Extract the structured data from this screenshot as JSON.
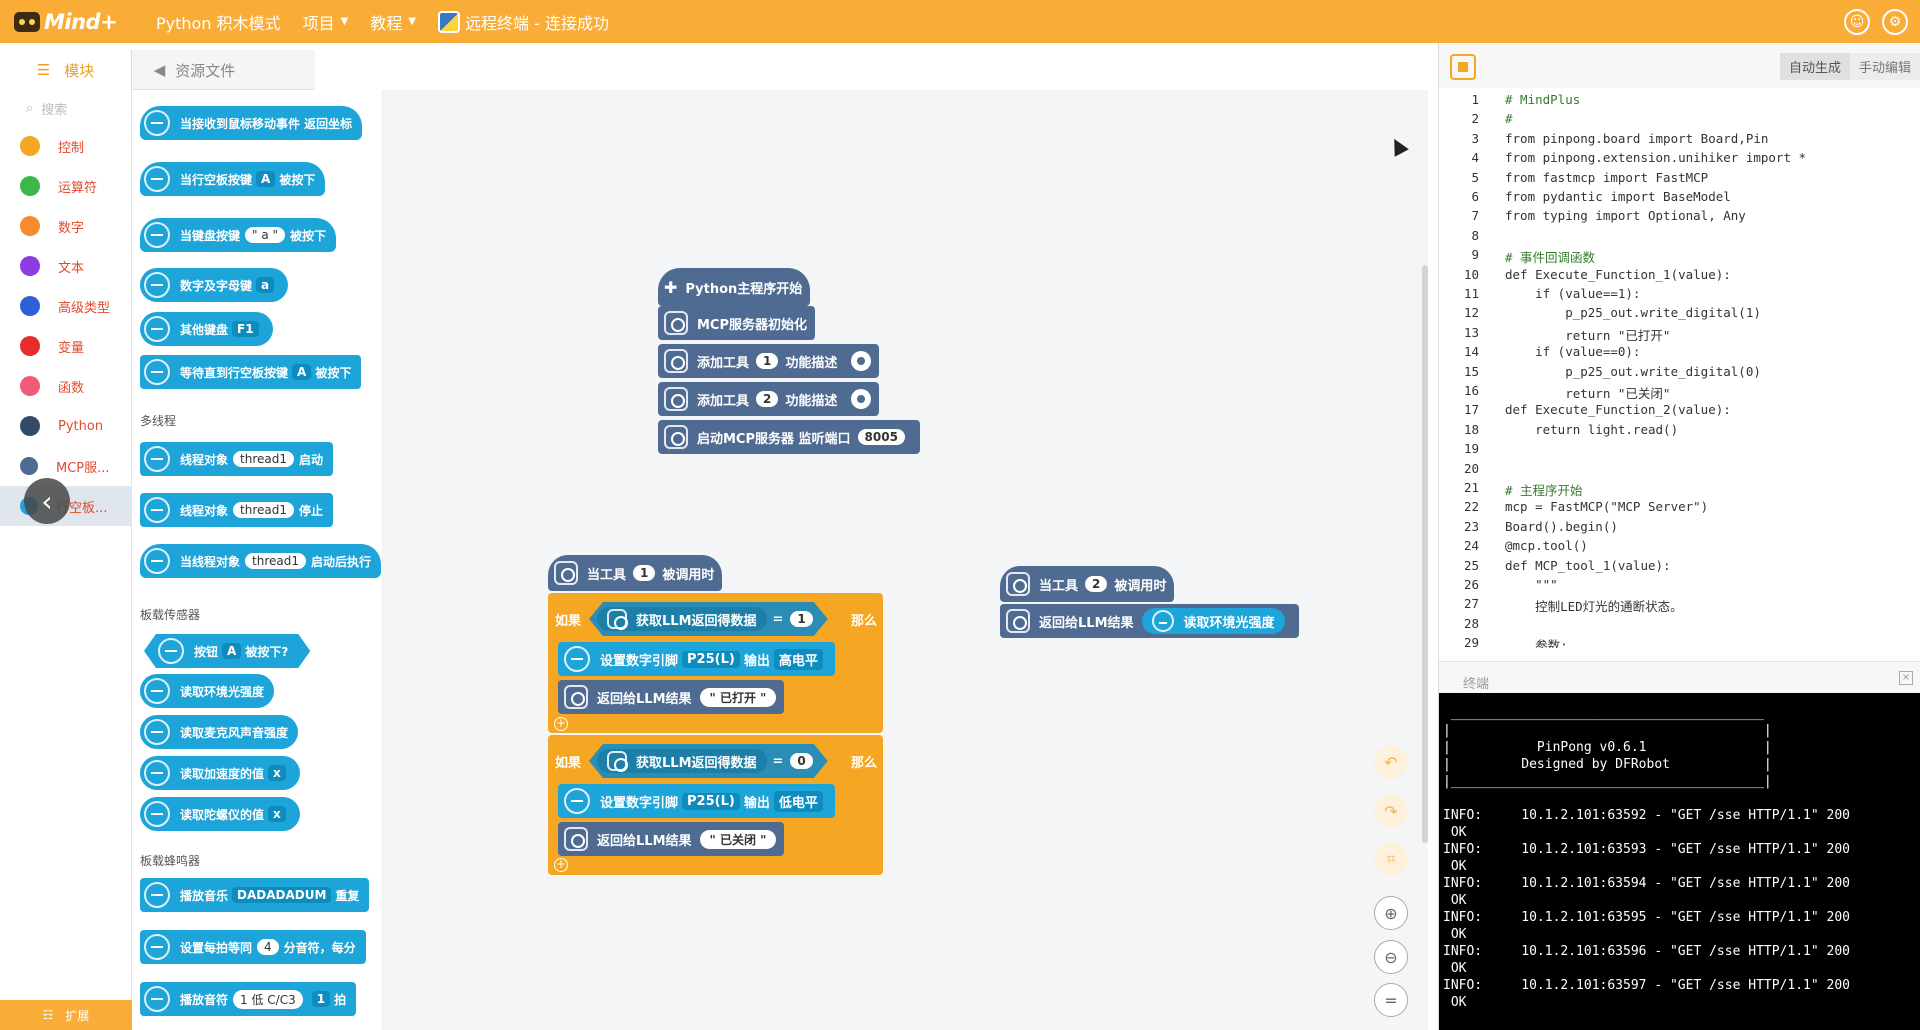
{
  "colors": {
    "brand": "#f9ad36",
    "block_blue": "#1da4d9",
    "mcp_block": "#4f6b92",
    "if_block": "#f5a623"
  },
  "topbar": {
    "logo_text": "Mind+",
    "mode": "Python 积木模式",
    "menu_project": "项目",
    "menu_tutorial": "教程",
    "remote_status": "远程终端 - 连接成功"
  },
  "left_tabs": {
    "blocks": "模块",
    "resources": "资源文件"
  },
  "categories": {
    "search_placeholder": "搜索",
    "items": [
      {
        "label": "控制",
        "color": "#f5a623"
      },
      {
        "label": "运算符",
        "color": "#3cb84a"
      },
      {
        "label": "数字",
        "color": "#f78c2f"
      },
      {
        "label": "文本",
        "color": "#8c3ce0"
      },
      {
        "label": "高级类型",
        "color": "#2f5ed6"
      },
      {
        "label": "变量",
        "color": "#e82c2c"
      },
      {
        "label": "函数",
        "color": "#f05c78"
      },
      {
        "label": "Python",
        "color": "#334a66"
      },
      {
        "label": "MCP服...",
        "color": "#4f6b92"
      },
      {
        "label": "行空板...",
        "color": "#1da4d9"
      }
    ],
    "extension": "扩展"
  },
  "palette": {
    "b1": "当接收到鼠标移动事件 返回坐标",
    "b2_pre": "当行空板按键",
    "b2_dd": "A",
    "b2_post": "被按下",
    "b3_pre": "当键盘按键",
    "b3_str": "\" a \"",
    "b3_post": "被按下",
    "b4_pre": "数字及字母键",
    "b4_dd": "a",
    "b5_pre": "其他键盘",
    "b5_dd": "F1",
    "b6_pre": "等待直到行空板按键",
    "b6_dd": "A",
    "b6_post": "被按下",
    "section_thread": "多线程",
    "t1_pre": "线程对象",
    "t1_str": "thread1",
    "t1_post": "启动",
    "t2_pre": "线程对象",
    "t2_str": "thread1",
    "t2_post": "停止",
    "t3_pre": "当线程对象",
    "t3_str": "thread1",
    "t3_post": "启动后执行",
    "section_sensor": "板载传感器",
    "s1_pre": "按钮",
    "s1_dd": "A",
    "s1_post": "被按下?",
    "s2": "读取环境光强度",
    "s3": "读取麦克风声音强度",
    "s4_pre": "读取加速度的值",
    "s4_dd": "x",
    "s5_pre": "读取陀螺仪的值",
    "s5_dd": "x",
    "section_buzzer": "板载蜂鸣器",
    "z1_pre": "播放音乐",
    "z1_dd": "DADADADUM",
    "z1_post": "重复",
    "z2_pre": "设置每拍等同",
    "z2_num": "4",
    "z2_post": "分音符，每分",
    "z3_pre": "播放音符",
    "z3_dd1": "1 低 C/C3",
    "z3_dd2": "1",
    "z3_post": "拍"
  },
  "workspace": {
    "main_start": "Python主程序开始",
    "mcp_init": "MCP服务器初始化",
    "add_tool": "添加工具",
    "tool1": "1",
    "tool2": "2",
    "func_desc": "功能描述",
    "start_server": "启动MCP服务器 监听端口",
    "port": "8005",
    "when_tool": "当工具",
    "called": "被调用时",
    "if": "如果",
    "then": "那么",
    "get_llm": "获取LLM返回得数据",
    "eq": "=",
    "val1": "1",
    "val0": "0",
    "set_pin": "设置数字引脚",
    "pin": "P25(L)",
    "output": "输出",
    "high": "高电平",
    "low": "低电平",
    "return_llm": "返回给LLM结果",
    "opened": "\" 已打开 \"",
    "closed": "\" 已关闭 \"",
    "read_light": "读取环境光强度"
  },
  "right_panel": {
    "auto_gen": "自动生成",
    "manual_edit": "手动编辑",
    "code_lines": [
      "# MindPlus",
      "#",
      "from pinpong.board import Board,Pin",
      "from pinpong.extension.unihiker import *",
      "from fastmcp import FastMCP",
      "from pydantic import BaseModel",
      "from typing import Optional, Any",
      "",
      "# 事件回调函数",
      "def Execute_Function_1(value):",
      "    if (value==1):",
      "        p_p25_out.write_digital(1)",
      "        return \"已打开\"",
      "    if (value==0):",
      "        p_p25_out.write_digital(0)",
      "        return \"已关闭\"",
      "def Execute_Function_2(value):",
      "    return light.read()",
      "",
      "",
      "# 主程序开始",
      "mcp = FastMCP(\"MCP Server\")",
      "Board().begin()",
      "@mcp.tool()",
      "def MCP_tool_1(value):",
      "    \"\"\"",
      "    控制LED灯光的通断状态。",
      "",
      "    参数:"
    ],
    "terminal_title": "终端",
    "terminal_lines": [
      " ________________________________________",
      "|                                        |",
      "|           PinPong v0.6.1               |",
      "|         Designed by DFRobot            |",
      "|________________________________________|",
      "",
      "INFO:     10.1.2.101:63592 - \"GET /sse HTTP/1.1\" 200",
      " OK",
      "INFO:     10.1.2.101:63593 - \"GET /sse HTTP/1.1\" 200",
      " OK",
      "INFO:     10.1.2.101:63594 - \"GET /sse HTTP/1.1\" 200",
      " OK",
      "INFO:     10.1.2.101:63595 - \"GET /sse HTTP/1.1\" 200",
      " OK",
      "INFO:     10.1.2.101:63596 - \"GET /sse HTTP/1.1\" 200",
      " OK",
      "INFO:     10.1.2.101:63597 - \"GET /sse HTTP/1.1\" 200",
      " OK"
    ]
  }
}
